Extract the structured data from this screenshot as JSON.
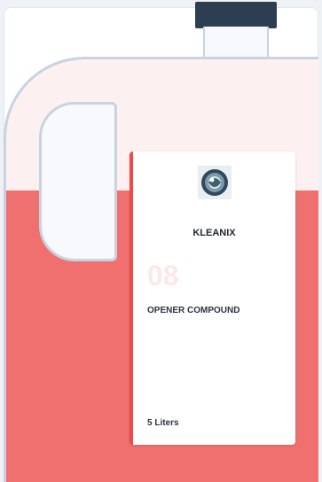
{
  "label": {
    "logo_icon": "globe-emblem-icon",
    "brand": "KLEANIX",
    "number": "08",
    "product_name": "OPENER COMPOUND",
    "volume": "5 Liters"
  },
  "colors": {
    "cap": "#2d3e52",
    "liquid": "#f07070",
    "jug_upper": "#fdf0f0",
    "accent": "#ef4a4a",
    "outline": "#c8d2e0"
  }
}
